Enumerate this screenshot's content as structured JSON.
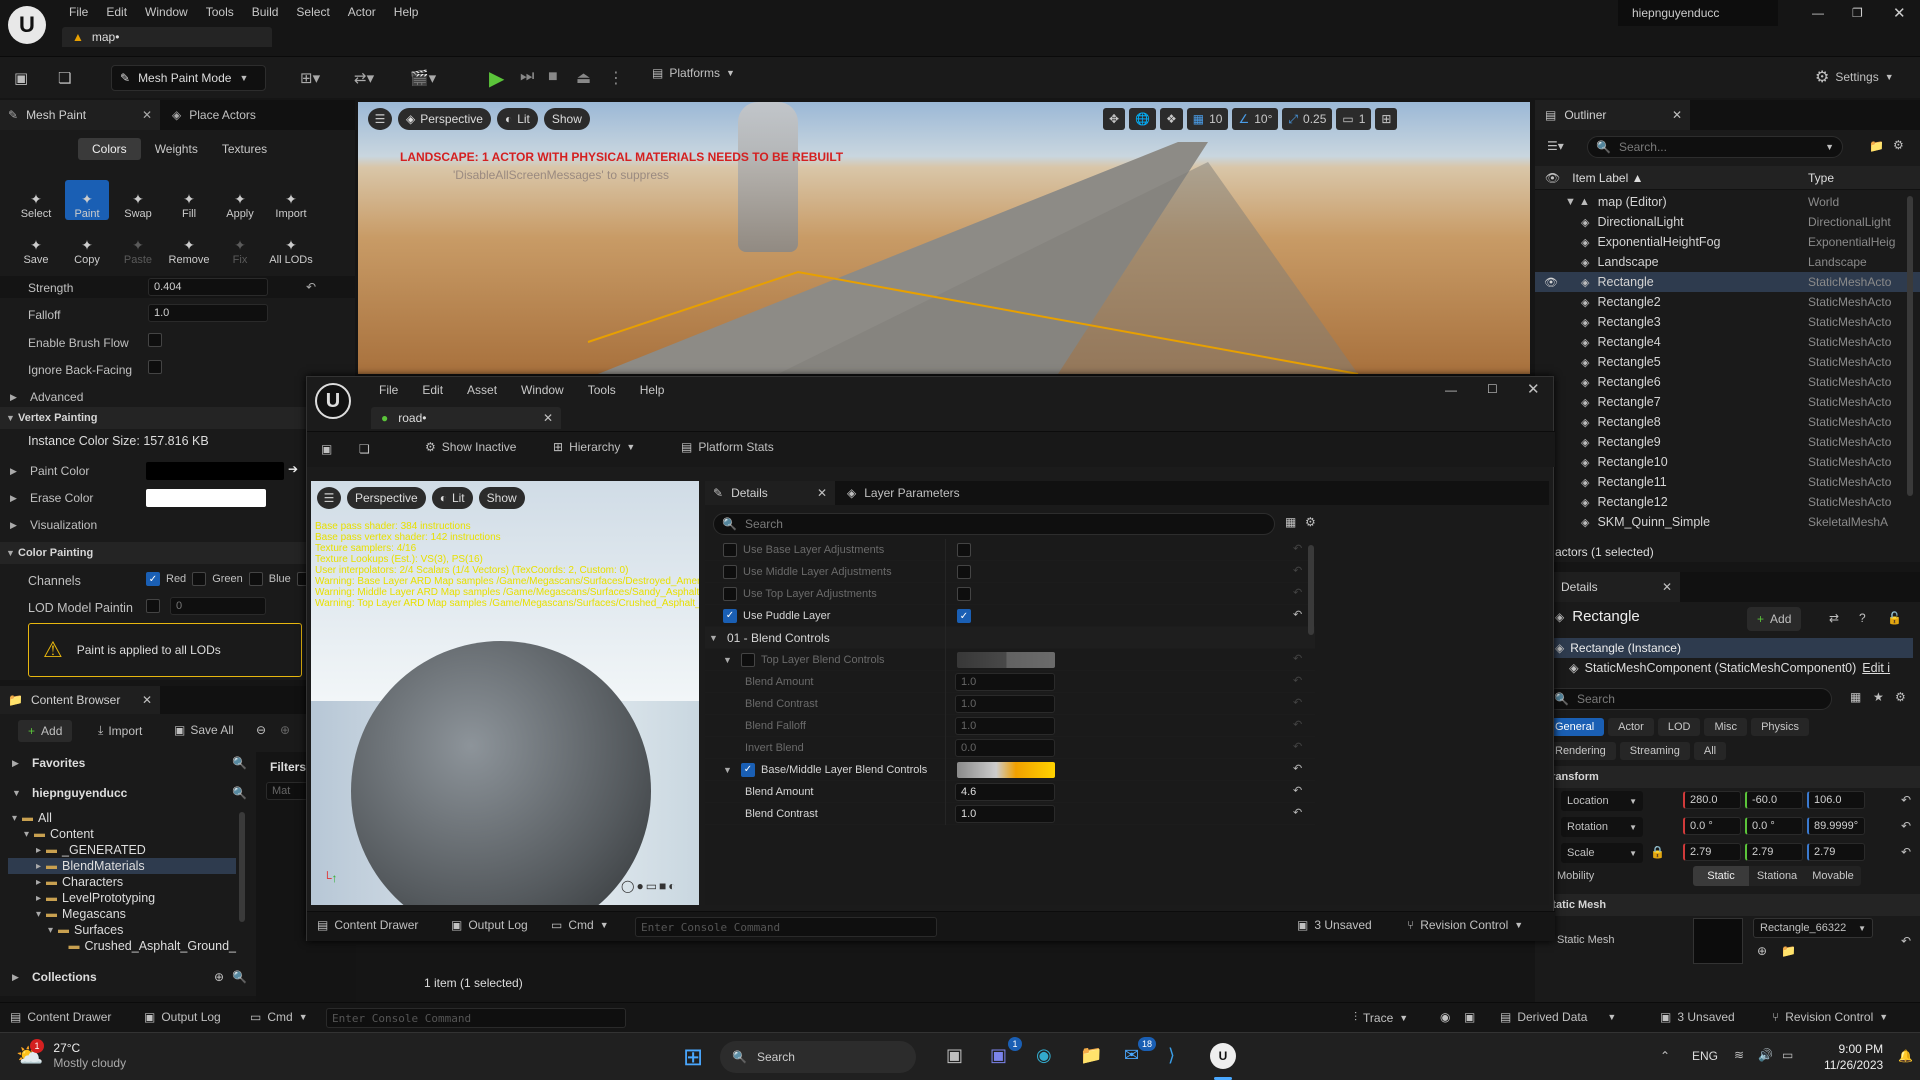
{
  "menubar": {
    "items": [
      "File",
      "Edit",
      "Window",
      "Tools",
      "Build",
      "Select",
      "Actor",
      "Help"
    ],
    "user": "hiepnguyenducc",
    "tab": "map•"
  },
  "toolbar": {
    "mode": "Mesh Paint Mode",
    "platforms": "Platforms",
    "settings": "Settings"
  },
  "mesh_paint": {
    "tab": "Mesh Paint",
    "place_tab": "Place Actors",
    "subtabs": [
      "Colors",
      "Weights",
      "Textures"
    ],
    "tools_row1": [
      "Select",
      "Paint",
      "Swap",
      "Fill",
      "Apply",
      "Import"
    ],
    "tools_row2": [
      "Save",
      "Copy",
      "Paste",
      "Remove",
      "Fix",
      "All LODs"
    ],
    "strength_label": "Strength",
    "strength_value": "0.404",
    "falloff_label": "Falloff",
    "falloff_value": "1.0",
    "brush_flow": "Enable Brush Flow",
    "back_facing": "Ignore Back-Facing",
    "advanced": "Advanced",
    "vertex_painting": "Vertex Painting",
    "instance_size": "Instance Color Size: 157.816 KB",
    "paint_color": "Paint Color",
    "erase_color": "Erase Color",
    "visualization": "Visualization",
    "color_painting": "Color Painting",
    "channels": "Channels",
    "ch_red": "Red",
    "ch_green": "Green",
    "ch_blue": "Blue",
    "lod_model": "LOD Model Paintin",
    "lod_value": "0",
    "warning": "Paint is applied to all LODs"
  },
  "viewport": {
    "perspective": "Perspective",
    "lit": "Lit",
    "show": "Show",
    "warning": "LANDSCAPE: 1 ACTOR WITH PHYSICAL MATERIALS NEEDS TO BE REBUILT",
    "suppress": "'DisableAllScreenMessages' to suppress",
    "grid": "10",
    "angle": "10°",
    "scale": "0.25",
    "cam": "1"
  },
  "outliner": {
    "tab": "Outliner",
    "search": "Search...",
    "col_label": "Item Label ▲",
    "col_type": "Type",
    "items": [
      {
        "label": "map (Editor)",
        "type": "World",
        "indent": 1
      },
      {
        "label": "DirectionalLight",
        "type": "DirectionalLight",
        "indent": 2
      },
      {
        "label": "ExponentialHeightFog",
        "type": "ExponentialHeig",
        "indent": 2
      },
      {
        "label": "Landscape",
        "type": "Landscape",
        "indent": 2
      },
      {
        "label": "Rectangle",
        "type": "StaticMeshActo",
        "indent": 2
      },
      {
        "label": "Rectangle2",
        "type": "StaticMeshActo",
        "indent": 2
      },
      {
        "label": "Rectangle3",
        "type": "StaticMeshActo",
        "indent": 2
      },
      {
        "label": "Rectangle4",
        "type": "StaticMeshActo",
        "indent": 2
      },
      {
        "label": "Rectangle5",
        "type": "StaticMeshActo",
        "indent": 2
      },
      {
        "label": "Rectangle6",
        "type": "StaticMeshActo",
        "indent": 2
      },
      {
        "label": "Rectangle7",
        "type": "StaticMeshActo",
        "indent": 2
      },
      {
        "label": "Rectangle8",
        "type": "StaticMeshActo",
        "indent": 2
      },
      {
        "label": "Rectangle9",
        "type": "StaticMeshActo",
        "indent": 2
      },
      {
        "label": "Rectangle10",
        "type": "StaticMeshActo",
        "indent": 2
      },
      {
        "label": "Rectangle11",
        "type": "StaticMeshActo",
        "indent": 2
      },
      {
        "label": "Rectangle12",
        "type": "StaticMeshActo",
        "indent": 2
      },
      {
        "label": "SKM_Quinn_Simple",
        "type": "SkeletalMeshA",
        "indent": 2
      }
    ],
    "status": "0 actors (1 selected)"
  },
  "details_right": {
    "tab": "Details",
    "name": "Rectangle",
    "add": "Add",
    "instance": "Rectangle (Instance)",
    "component": "StaticMeshComponent (StaticMeshComponent0)",
    "edit": "Edit i",
    "search": "Search",
    "cats1": [
      "General",
      "Actor",
      "LOD",
      "Misc",
      "Physics"
    ],
    "cats2": [
      "Rendering",
      "Streaming",
      "All"
    ],
    "transform": "Transform",
    "location": "Location",
    "loc": [
      "280.0",
      "-60.0",
      "106.0"
    ],
    "rotation": "Rotation",
    "rot": [
      "0.0 °",
      "0.0 °",
      "89.9999°"
    ],
    "scale": "Scale",
    "scl": [
      "2.79",
      "2.79",
      "2.79"
    ],
    "mobility": "Mobility",
    "mob": [
      "Static",
      "Stationa",
      "Movable"
    ],
    "static_mesh_sect": "Static Mesh",
    "static_mesh_label": "Static Mesh",
    "mesh_value": "Rectangle_66322"
  },
  "content_browser": {
    "tab": "Content Browser",
    "add": "Add",
    "import": "Import",
    "save_all": "Save All",
    "favorites": "Favorites",
    "user": "hiepnguyenducc",
    "filters": "Filters",
    "search_placeholder": "Mat",
    "tree": [
      {
        "label": "All",
        "depth": 0
      },
      {
        "label": "Content",
        "depth": 1
      },
      {
        "label": "_GENERATED",
        "depth": 2
      },
      {
        "label": "BlendMaterials",
        "depth": 2
      },
      {
        "label": "Characters",
        "depth": 2
      },
      {
        "label": "LevelPrototyping",
        "depth": 2
      },
      {
        "label": "Megascans",
        "depth": 2
      },
      {
        "label": "Surfaces",
        "depth": 3
      },
      {
        "label": "Crushed_Asphalt_Ground_",
        "depth": 4
      }
    ],
    "collections": "Collections",
    "status": "1 item (1 selected)"
  },
  "material_window": {
    "menu": [
      "File",
      "Edit",
      "Asset",
      "Window",
      "Tools",
      "Help"
    ],
    "tab": "road•",
    "toolbar": [
      "Show Inactive",
      "Hierarchy",
      "Platform Stats"
    ],
    "viewport_perspective": "Perspective",
    "viewport_lit": "Lit",
    "viewport_show": "Show",
    "stats": [
      "Base pass shader: 384 instructions",
      "Base pass vertex shader: 142 instructions",
      "Texture samplers: 4/16",
      "Texture Lookups (Est.): VS(3), PS(16)",
      "User interpolators: 2/4 Scalars (1/4 Vectors) (TexCoords: 2, Custom: 0)",
      "Warning: Base Layer ARD Map samples /Game/Megascans/Surfaces/Destroyed_American_Roa",
      "Warning: Middle Layer ARD Map samples /Game/Megascans/Surfaces/Sandy_Asphalt_sidcihk/",
      "Warning: Top Layer ARD Map samples /Game/Megascans/Surfaces/Crushed_Asphalt_Ground_"
    ],
    "details_tab": "Details",
    "layer_tab": "Layer Parameters",
    "search": "Search",
    "rows": [
      {
        "label": "Use Base Layer Adjustments",
        "kind": "bool",
        "checked": false,
        "dim": true
      },
      {
        "label": "Use Middle Layer Adjustments",
        "kind": "bool",
        "checked": false,
        "dim": true
      },
      {
        "label": "Use Top Layer Adjustments",
        "kind": "bool",
        "checked": false,
        "dim": true
      },
      {
        "label": "Use Puddle Layer",
        "kind": "bool",
        "checked": true,
        "dim": false
      },
      {
        "label": "01 - Blend Controls",
        "kind": "section"
      },
      {
        "label": "Top Layer Blend Controls",
        "kind": "group",
        "checked": false,
        "dim": true
      },
      {
        "label": "Blend Amount",
        "kind": "value",
        "value": "1.0",
        "dim": true
      },
      {
        "label": "Blend Contrast",
        "kind": "value",
        "value": "1.0",
        "dim": true
      },
      {
        "label": "Blend Falloff",
        "kind": "value",
        "value": "1.0",
        "dim": true
      },
      {
        "label": "Invert Blend",
        "kind": "value",
        "value": "0.0",
        "dim": true
      },
      {
        "label": "Base/Middle Layer Blend Controls",
        "kind": "group2",
        "checked": true,
        "dim": false
      },
      {
        "label": "Blend Amount",
        "kind": "value",
        "value": "4.6",
        "dim": false
      },
      {
        "label": "Blend Contrast",
        "kind": "value",
        "value": "1.0",
        "dim": false
      }
    ],
    "bottom": {
      "drawer": "Content Drawer",
      "output": "Output Log",
      "cmd": "Cmd",
      "console": "Enter Console Command",
      "unsaved": "3 Unsaved",
      "revision": "Revision Control"
    }
  },
  "statusbar": {
    "drawer": "Content Drawer",
    "output": "Output Log",
    "cmd": "Cmd",
    "console": "Enter Console Command",
    "trace": "Trace",
    "derived": "Derived Data",
    "unsaved": "3 Unsaved",
    "revision": "Revision Control"
  },
  "taskbar": {
    "temp": "27°C",
    "weather": "Mostly cloudy",
    "search": "Search",
    "lang": "ENG",
    "time": "9:00 PM",
    "date": "11/26/2023",
    "badge_teams": "1",
    "badge_mail": "18",
    "badge_weather": "1"
  },
  "colors": {
    "accent": "#1a5fb4",
    "warn": "#e8b70f",
    "red_text": "#d42020"
  }
}
